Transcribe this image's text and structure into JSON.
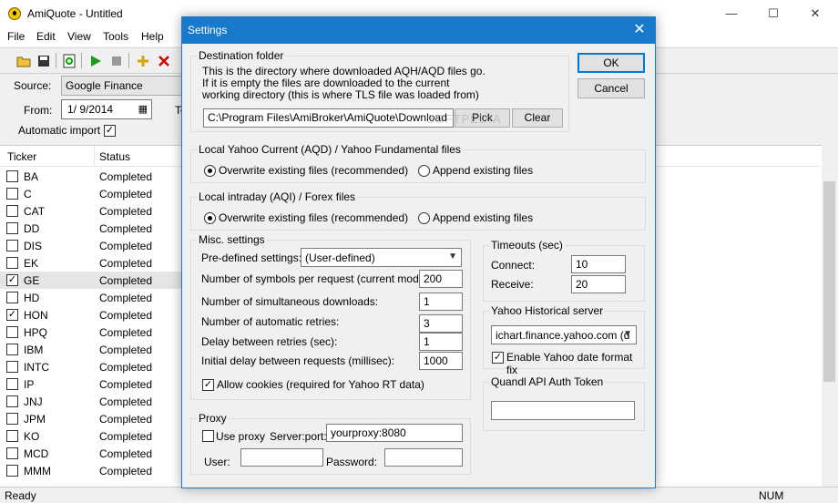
{
  "app": {
    "title": "AmiQuote - Untitled",
    "window_controls": {
      "minimize": "—",
      "maximize": "☐",
      "close": "✕"
    }
  },
  "menu": [
    "File",
    "Edit",
    "View",
    "Tools",
    "Help"
  ],
  "source": {
    "source_label": "Source:",
    "source_value": "Google Finance",
    "from_label": "From:",
    "from_value": "1/ 9/2014",
    "to_label": "To",
    "auto_import_label": "Automatic import",
    "auto_import_checked": true
  },
  "list": {
    "headers": [
      "Ticker",
      "Status"
    ],
    "rows": [
      {
        "ticker": "BA",
        "status": "Completed",
        "checked": false
      },
      {
        "ticker": "C",
        "status": "Completed",
        "checked": false
      },
      {
        "ticker": "CAT",
        "status": "Completed",
        "checked": false
      },
      {
        "ticker": "DD",
        "status": "Completed",
        "checked": false
      },
      {
        "ticker": "DIS",
        "status": "Completed",
        "checked": false
      },
      {
        "ticker": "EK",
        "status": "Completed",
        "checked": false
      },
      {
        "ticker": "GE",
        "status": "Completed",
        "checked": true
      },
      {
        "ticker": "HD",
        "status": "Completed",
        "checked": false
      },
      {
        "ticker": "HON",
        "status": "Completed",
        "checked": true
      },
      {
        "ticker": "HPQ",
        "status": "Completed",
        "checked": false
      },
      {
        "ticker": "IBM",
        "status": "Completed",
        "checked": false
      },
      {
        "ticker": "INTC",
        "status": "Completed",
        "checked": false
      },
      {
        "ticker": "IP",
        "status": "Completed",
        "checked": false
      },
      {
        "ticker": "JNJ",
        "status": "Completed",
        "checked": false
      },
      {
        "ticker": "JPM",
        "status": "Completed",
        "checked": false
      },
      {
        "ticker": "KO",
        "status": "Completed",
        "checked": false
      },
      {
        "ticker": "MCD",
        "status": "Completed",
        "checked": false
      },
      {
        "ticker": "MMM",
        "status": "Completed",
        "checked": false
      }
    ]
  },
  "statusbar": {
    "left": "Ready",
    "right": "NUM"
  },
  "dialog": {
    "title": "Settings",
    "ok": "OK",
    "cancel": "Cancel",
    "dest": {
      "title": "Destination folder",
      "desc1": "This is the directory where downloaded AQH/AQD files go.",
      "desc2": "If it is empty the files are downloaded to the current",
      "desc3": "working directory (this is where TLS file was loaded from)",
      "path": "C:\\Program Files\\AmiBroker\\AmiQuote\\Download",
      "pick": "Pick",
      "clear": "Clear"
    },
    "yahoo_current": {
      "title": "Local Yahoo Current (AQD) / Yahoo Fundamental files",
      "overwrite": "Overwrite existing files (recommended)",
      "append": "Append existing files"
    },
    "intraday": {
      "title": "Local intraday (AQI) / Forex files",
      "overwrite": "Overwrite existing files (recommended)",
      "append": "Append existing files"
    },
    "misc": {
      "title": "Misc. settings",
      "predefined_label": "Pre-defined settings:",
      "predefined_value": "(User-defined)",
      "symbols_label": "Number of symbols per request (current mode):",
      "symbols_value": "200",
      "simul_label": "Number of simultaneous downloads:",
      "simul_value": "1",
      "retries_label": "Number of automatic retries:",
      "retries_value": "3",
      "delay_label": "Delay between retries (sec):",
      "delay_value": "1",
      "initdelay_label": "Initial delay between requests (millisec):",
      "initdelay_value": "1000",
      "cookies_label": "Allow cookies (required for Yahoo RT data)"
    },
    "timeouts": {
      "title": "Timeouts (sec)",
      "connect_label": "Connect:",
      "connect_value": "10",
      "receive_label": "Receive:",
      "receive_value": "20"
    },
    "yahoo_hist": {
      "title": "Yahoo Historical server",
      "server_value": "ichart.finance.yahoo.com (d",
      "fix_label": "Enable Yahoo date format fix"
    },
    "quandl": {
      "title": "Quandl API Auth Token",
      "value": ""
    },
    "proxy": {
      "title": "Proxy",
      "use_label": "Use proxy",
      "server_label": "Server:port:",
      "server_value": "yourproxy:8080",
      "user_label": "User:",
      "user_value": "",
      "pass_label": "Password:",
      "pass_value": ""
    },
    "watermark": "SOFTPEDIA"
  }
}
